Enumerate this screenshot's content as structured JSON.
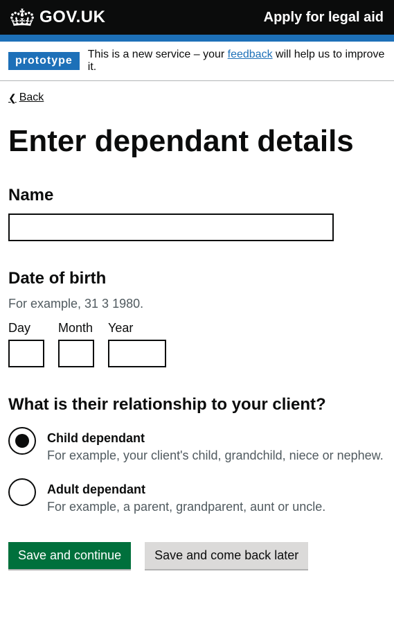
{
  "header": {
    "logo_text": "GOV.UK",
    "service_name": "Apply for legal aid"
  },
  "phase": {
    "tag": "prototype",
    "text_before": "This is a new service – your ",
    "link": "feedback",
    "text_after": " will help us to improve it."
  },
  "back": {
    "label": "Back"
  },
  "page": {
    "title": "Enter dependant details"
  },
  "name": {
    "label": "Name",
    "value": ""
  },
  "dob": {
    "label": "Date of birth",
    "hint": "For example, 31 3 1980.",
    "day_label": "Day",
    "month_label": "Month",
    "year_label": "Year",
    "day": "",
    "month": "",
    "year": ""
  },
  "relationship": {
    "legend": "What is their relationship to your client?",
    "options": [
      {
        "label": "Child dependant",
        "hint": "For example, your client's child, grandchild, niece or nephew.",
        "checked": true
      },
      {
        "label": "Adult dependant",
        "hint": "For example, a parent, grandparent, aunt or uncle.",
        "checked": false
      }
    ]
  },
  "buttons": {
    "primary": "Save and continue",
    "secondary": "Save and come back later"
  }
}
